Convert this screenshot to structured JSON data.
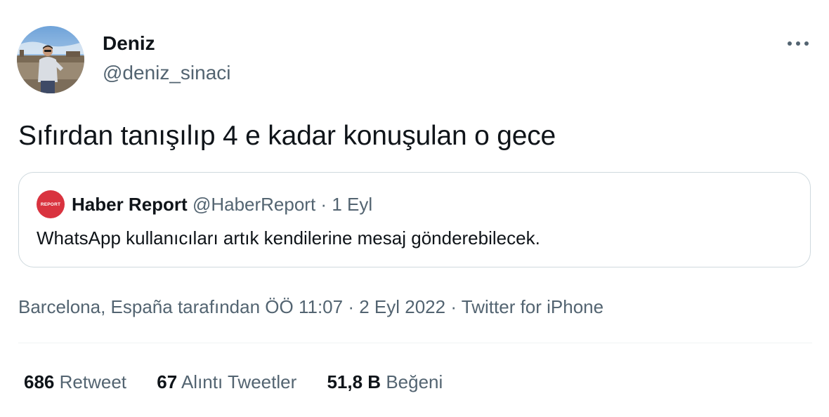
{
  "author": {
    "display_name": "Deniz",
    "handle": "@deniz_sinaci",
    "avatar": "profile-photo"
  },
  "tweet": {
    "text": "Sıfırdan tanışılıp 4 e kadar konuşulan o gece"
  },
  "quoted_tweet": {
    "display_name": "Haber Report",
    "handle": "@HaberReport",
    "separator": "·",
    "date": "1 Eyl",
    "text": "WhatsApp kullanıcıları artık kendilerine mesaj gönderebilecek.",
    "avatar_text": "REPORT",
    "avatar_color": "#d9333f"
  },
  "meta": {
    "location": "Barcelona, España",
    "location_suffix": "tarafından",
    "time": "ÖÖ 11:07",
    "separator": "·",
    "date": "2 Eyl 2022",
    "source": "Twitter for iPhone"
  },
  "stats": {
    "retweets": {
      "count": "686",
      "label": "Retweet"
    },
    "quotes": {
      "count": "67",
      "label": "Alıntı Tweetler"
    },
    "likes": {
      "count": "51,8 B",
      "label": "Beğeni"
    }
  },
  "icons": {
    "more": "more-horizontal-icon"
  },
  "colors": {
    "text_primary": "#0f1419",
    "text_secondary": "#536471",
    "border": "#cfd9de"
  }
}
